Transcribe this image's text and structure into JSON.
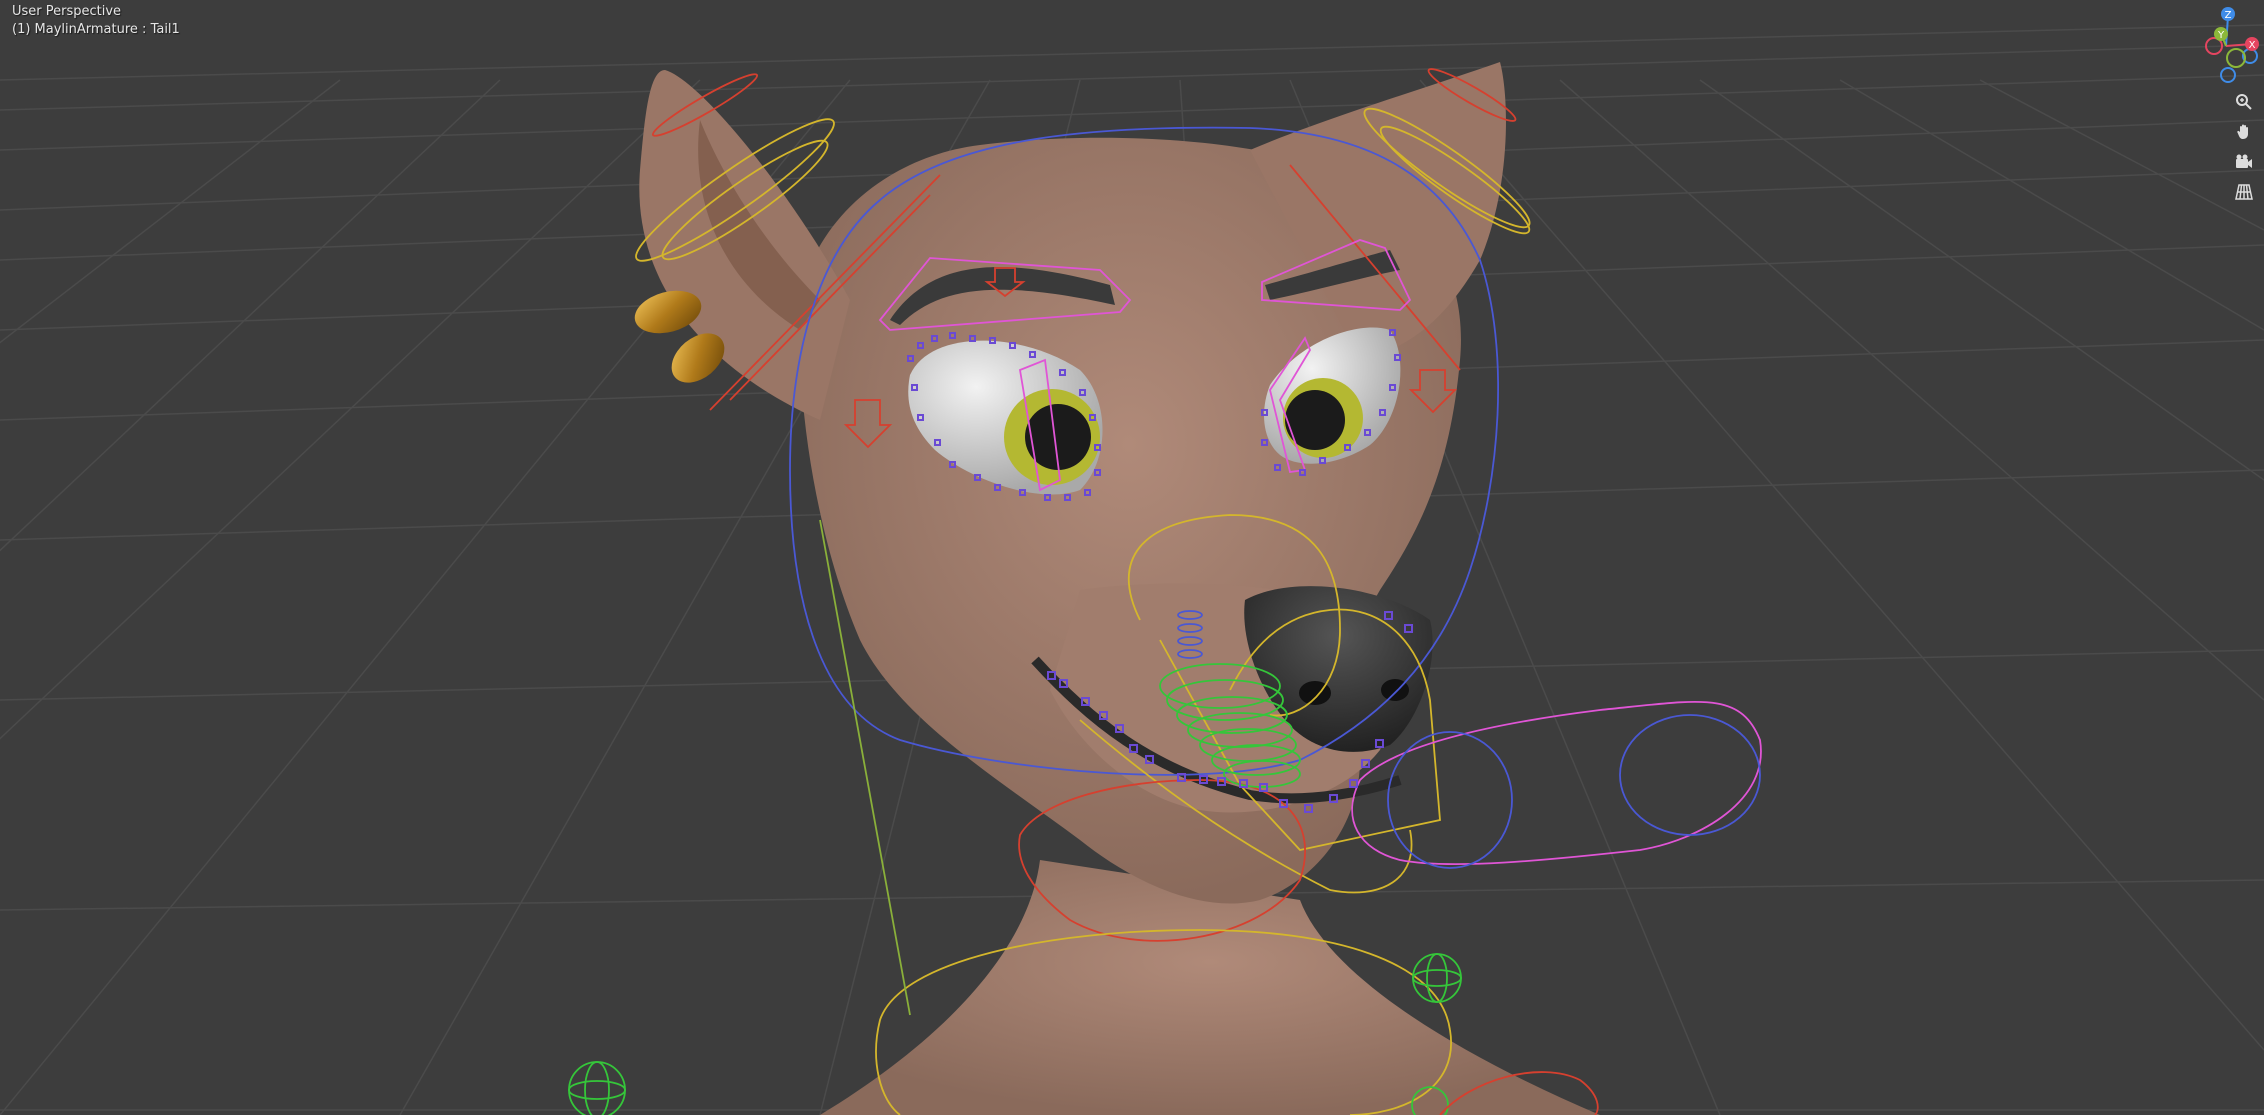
{
  "viewport": {
    "title": "User Perspective",
    "object_info": "(1) MaylinArmature : Tail1",
    "background": "#3d3d3d",
    "grid_color": "#4a4a4a"
  },
  "gizmo": {
    "axis_z": "Z",
    "axis_y": "Y",
    "axis_x": "X",
    "colors": {
      "x": "#e54560",
      "y": "#8cb83a",
      "z": "#3f8ce8"
    }
  },
  "nav_buttons": [
    {
      "name": "zoom-icon"
    },
    {
      "name": "pan-hand-icon"
    },
    {
      "name": "camera-icon"
    },
    {
      "name": "perspective-grid-icon"
    }
  ],
  "scene": {
    "skin_color": "#a58272",
    "armature_bone_colors": [
      "#d4b62c",
      "#d6402f",
      "#4a58d4",
      "#e055d6",
      "#35c63a",
      "#6a4ad4"
    ]
  }
}
